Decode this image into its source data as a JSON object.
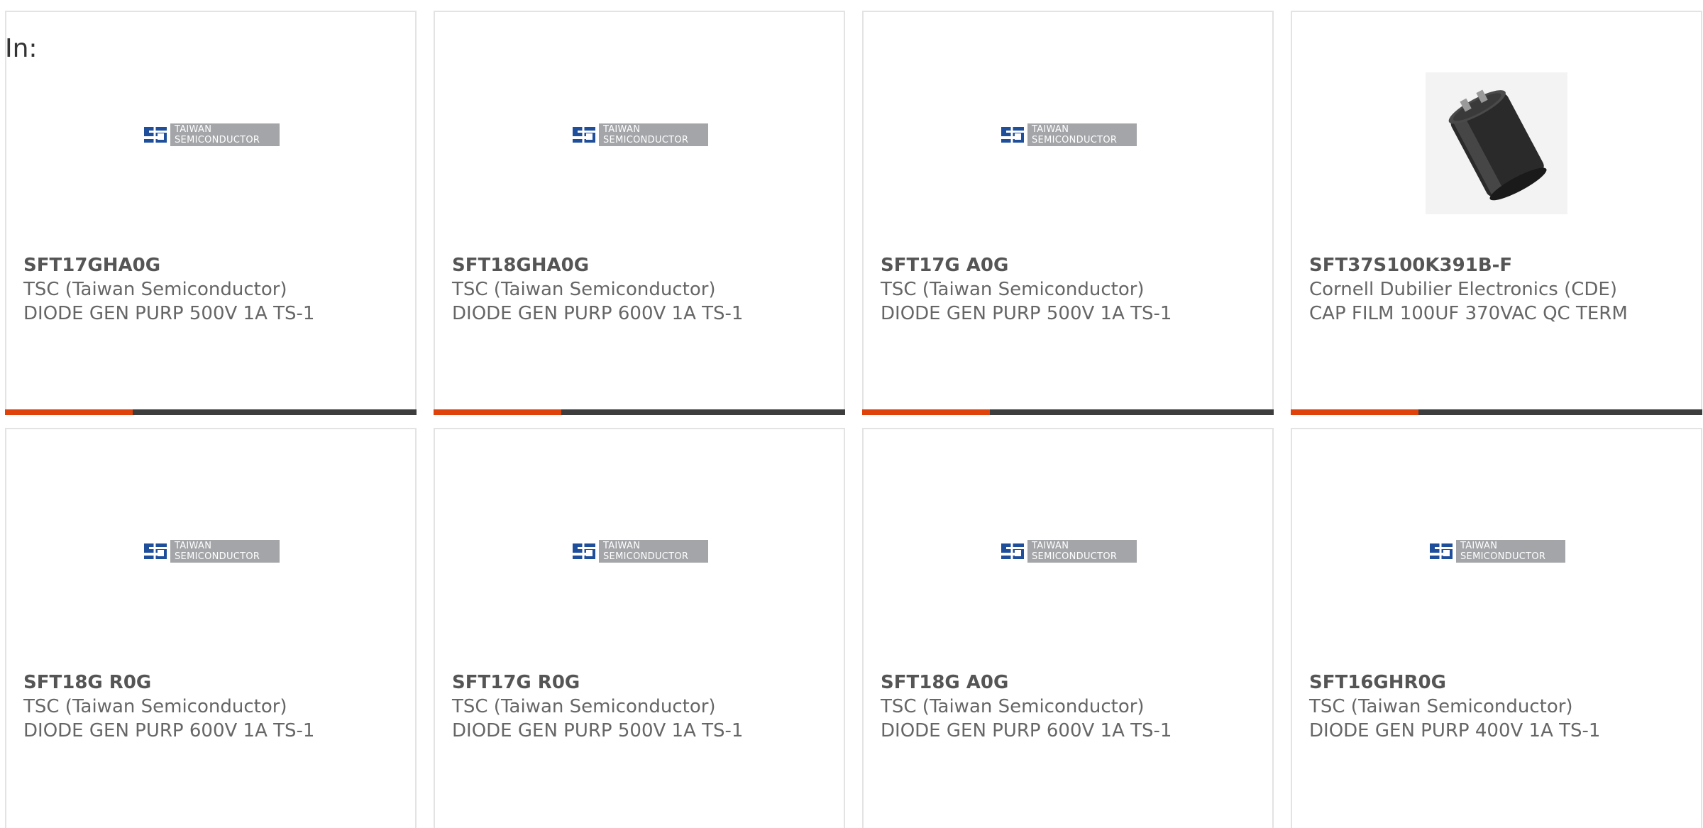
{
  "header": {
    "in_label": "In:"
  },
  "logo": {
    "line1": "TAIWAN",
    "line2": "SEMICONDUCTOR"
  },
  "colors": {
    "accent": "#e0420c",
    "track": "#3d3d3d",
    "logo_blue": "#1f4e9a",
    "logo_gray": "#a3a5a8"
  },
  "products": [
    {
      "part": "SFT17GHA0G",
      "manufacturer": "TSC (Taiwan Semiconductor)",
      "description": "DIODE GEN PURP 500V 1A TS-1",
      "image": "taiwan-semiconductor-logo"
    },
    {
      "part": "SFT18GHA0G",
      "manufacturer": "TSC (Taiwan Semiconductor)",
      "description": "DIODE GEN PURP 600V 1A TS-1",
      "image": "taiwan-semiconductor-logo"
    },
    {
      "part": "SFT17G A0G",
      "manufacturer": "TSC (Taiwan Semiconductor)",
      "description": "DIODE GEN PURP 500V 1A TS-1",
      "image": "taiwan-semiconductor-logo"
    },
    {
      "part": "SFT37S100K391B-F",
      "manufacturer": "Cornell Dubilier Electronics (CDE)",
      "description": "CAP FILM 100UF 370VAC QC TERM",
      "image": "capacitor-photo"
    },
    {
      "part": "SFT18G R0G",
      "manufacturer": "TSC (Taiwan Semiconductor)",
      "description": "DIODE GEN PURP 600V 1A TS-1",
      "image": "taiwan-semiconductor-logo"
    },
    {
      "part": "SFT17G R0G",
      "manufacturer": "TSC (Taiwan Semiconductor)",
      "description": "DIODE GEN PURP 500V 1A TS-1",
      "image": "taiwan-semiconductor-logo"
    },
    {
      "part": "SFT18G A0G",
      "manufacturer": "TSC (Taiwan Semiconductor)",
      "description": "DIODE GEN PURP 600V 1A TS-1",
      "image": "taiwan-semiconductor-logo"
    },
    {
      "part": "SFT16GHR0G",
      "manufacturer": "TSC (Taiwan Semiconductor)",
      "description": "DIODE GEN PURP 400V 1A TS-1",
      "image": "taiwan-semiconductor-logo"
    }
  ],
  "progress_fraction": 0.31
}
